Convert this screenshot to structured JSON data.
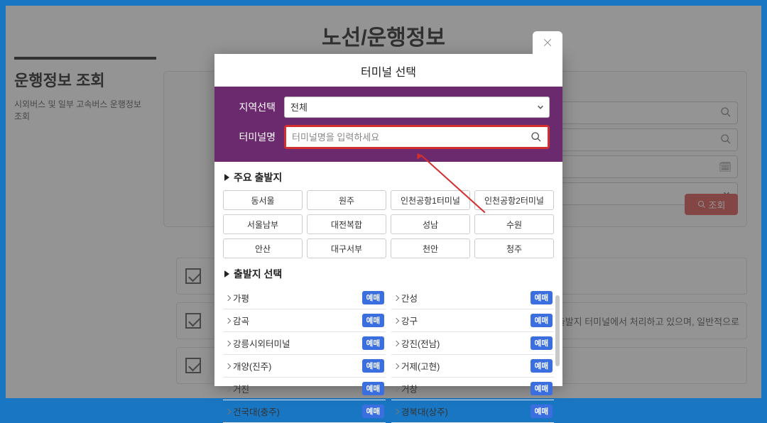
{
  "page": {
    "title": "노선/운행정보",
    "left": {
      "heading": "운행정보 조회",
      "sub": "시외버스 및 일부 고속버스 운행정보 조회"
    },
    "main": {
      "searchBtn": "조회",
      "info2": "은 출발지 터미널에서 처리하고 있으며, 일반적으로"
    }
  },
  "modal": {
    "title": "터미널 선택",
    "regionLabel": "지역선택",
    "regionValue": "전체",
    "nameLabel": "터미널명",
    "namePlaceholder": "터미널명을 입력하세요",
    "majorHeading": "주요 출발지",
    "majorChips": [
      "동서울",
      "원주",
      "인천공항1터미널",
      "인천공항2터미널",
      "서울남부",
      "대전복합",
      "성남",
      "수원",
      "안산",
      "대구서부",
      "천안",
      "청주"
    ],
    "departHeading": "출발지 선택",
    "badge": "예매",
    "terminals": [
      [
        "가평",
        "간성"
      ],
      [
        "감곡",
        "강구"
      ],
      [
        "강릉시외터미널",
        "강진(전남)"
      ],
      [
        "개양(진주)",
        "거제(고현)"
      ],
      [
        "거진",
        "거창"
      ],
      [
        "건국대(충주)",
        "경북대(상주)"
      ]
    ]
  }
}
